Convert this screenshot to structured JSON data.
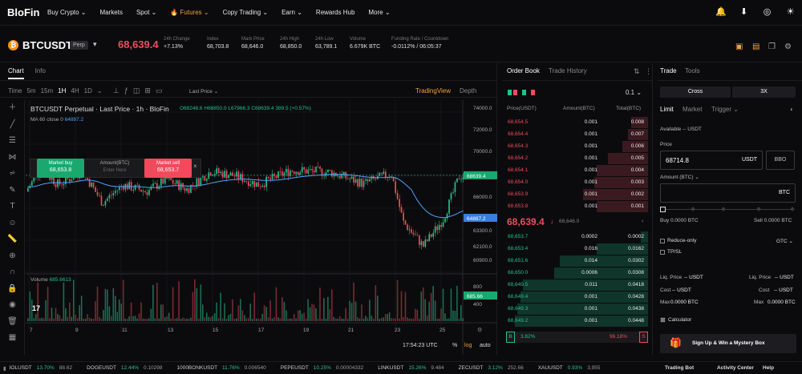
{
  "nav": {
    "logo": "BloFin",
    "items": [
      "Buy Crypto ⌄",
      "Markets",
      "Spot ⌄",
      "🔥 Futures ⌄",
      "Copy Trading ⌄",
      "Earn ⌄",
      "Rewards Hub",
      "More ⌄"
    ]
  },
  "ticker_bar": {
    "symbol": "BTCUSDT",
    "type": "Perp",
    "price": "68,639.4",
    "stats": [
      {
        "label": "24h Change",
        "value": "+7.13%",
        "color": "g"
      },
      {
        "label": "Index",
        "value": "68,703.8",
        "color": ""
      },
      {
        "label": "Mark Price",
        "value": "68,646.0",
        "color": ""
      },
      {
        "label": "24h High",
        "value": "68,850.0",
        "color": ""
      },
      {
        "label": "24h Low",
        "value": "63,789.1",
        "color": ""
      },
      {
        "label": "Volume",
        "value": "6.679K BTC",
        "color": ""
      },
      {
        "label": "Funding Rate / Countdown",
        "value": "-0.0112%",
        "value2": " / 06:05:37",
        "color": "r"
      }
    ]
  },
  "chart": {
    "tabs": [
      "Chart",
      "Info"
    ],
    "timeframes": [
      "Time",
      "5m",
      "15m",
      "1H",
      "4H",
      "1D",
      "⌄"
    ],
    "active_tf": "1H",
    "price_type": "Last Price ⌄",
    "tradingview": "TradingView",
    "depth": "Depth",
    "title": "BTCUSDT Perpetual · Last Price · 1h · BloFin",
    "ohlc": {
      "o": "O68248.6",
      "h": "H68850.0",
      "l": "L67966.3",
      "c": "C68639.4",
      "chg": "389.5 (+0.57%)"
    },
    "ma_label": "MA 60 close 0",
    "ma_value": "64887.2",
    "market_buy": "Market buy",
    "buy_price": "68,653.8",
    "amount_label": "Amount(BTC)",
    "amount_ph": "Enter Here",
    "market_sell": "Market sell",
    "sell_price": "68,653.7",
    "price_ticks": [
      "74000.0",
      "72000.0",
      "70000.0",
      "68000.0",
      "66000.0",
      "64000.0",
      "63300.0",
      "62100.0",
      "60900.0"
    ],
    "last_tag": "68639.4",
    "ma_tag": "64887.2",
    "volume_label": "Volume",
    "volume_value": "685.6613",
    "vol_ticks": [
      "800",
      "400"
    ],
    "vol_tag": "685.66",
    "date_ticks": [
      "7",
      "9",
      "11",
      "13",
      "15",
      "17",
      "19",
      "21",
      "23",
      "25"
    ],
    "time": "17:54:23 UTC",
    "pct": "%",
    "log": "log",
    "auto": "auto"
  },
  "chart_data": {
    "type": "candlestick",
    "ylim": [
      60300,
      74700
    ],
    "last": 68639.4,
    "ma": 64887.2,
    "volume_last": 685.6613,
    "vol_max": 800
  },
  "orderbook": {
    "tabs": [
      "Order Book",
      "Trade History"
    ],
    "precision": "0.1 ⌄",
    "headers": [
      "Price(USDT)",
      "Amount(BTC)",
      "Total(BTC)"
    ],
    "asks": [
      [
        "68,654.5",
        "0.001",
        "0.008",
        0.12
      ],
      [
        "68,654.4",
        "0.001",
        "0.007",
        0.14
      ],
      [
        "68,654.3",
        "0.001",
        "0.006",
        0.18
      ],
      [
        "68,654.2",
        "0.001",
        "0.005",
        0.28
      ],
      [
        "68,654.1",
        "0.001",
        "0.004",
        0.36
      ],
      [
        "68,654.0",
        "0.001",
        "0.003",
        0.38
      ],
      [
        "68,653.9",
        "0.001",
        "0.002",
        0.46
      ],
      [
        "68,653.8",
        "0.001",
        "0.001",
        0.36
      ]
    ],
    "mid_price": "68,639.4",
    "mid_mark": "68,646.0",
    "bids": [
      [
        "68,653.7",
        "0.0002",
        "0.0002",
        0.05
      ],
      [
        "68,653.4",
        "0.016",
        "0.0162",
        0.36
      ],
      [
        "68,651.6",
        "0.014",
        "0.0302",
        0.62
      ],
      [
        "68,650.0",
        "0.0006",
        "0.0308",
        0.66
      ],
      [
        "68,649.5",
        "0.011",
        "0.0418",
        0.88
      ],
      [
        "68,649.4",
        "0.001",
        "0.0428",
        0.9
      ],
      [
        "68,649.3",
        "0.001",
        "0.0438",
        0.92
      ],
      [
        "68,649.2",
        "0.001",
        "0.0448",
        0.94
      ]
    ],
    "b_label": "B",
    "b_pct": "3.82%",
    "s_pct": "96.18%",
    "s_label": "S"
  },
  "trade": {
    "tabs": [
      "Trade",
      "Tools"
    ],
    "cross": "Cross",
    "lev": "3X",
    "types": [
      "Limit",
      "Market",
      "Trigger ⌄"
    ],
    "available": "Available -- USDT",
    "price_label": "Price",
    "price_value": "68714.8",
    "unit": "USDT",
    "bbo": "BBO",
    "amount_label": "Amount (BTC) ⌄",
    "amount_unit": "BTC",
    "buy_info": "Buy 0.0000 BTC",
    "sell_info": "Sell 0.0000 BTC",
    "reduce": "Reduce-only",
    "tpsl": "TP/SL",
    "gtc": "GTC ⌄",
    "liq_l": "Liq. Price",
    "liq_v": "-- USDT",
    "cost_l": "Cost",
    "cost_v": "-- USDT",
    "max_l": "Max",
    "max_v": "0.0000 BTC",
    "calc": "Calculator",
    "promo": "Sign Up & Win a Mystery Box"
  },
  "bottom": {
    "items": [
      [
        "IOLUSDT",
        "13.70%",
        "88.62"
      ],
      [
        "DOGEUSDT",
        "12.44%",
        "0.10298"
      ],
      [
        "1000BONKUSDT",
        "11.76%",
        "0.006540"
      ],
      [
        "PEPEUSDT",
        "10.25%",
        "0.00004332"
      ],
      [
        "LINKUSDT",
        "15.26%",
        "9.484"
      ],
      [
        "ZECUSDT",
        "3.12%",
        "252.66"
      ],
      [
        "XAUUSDT",
        "0.93%",
        "3,955"
      ]
    ],
    "right": [
      "Trading Bot",
      "Activity Center",
      "Help"
    ]
  }
}
